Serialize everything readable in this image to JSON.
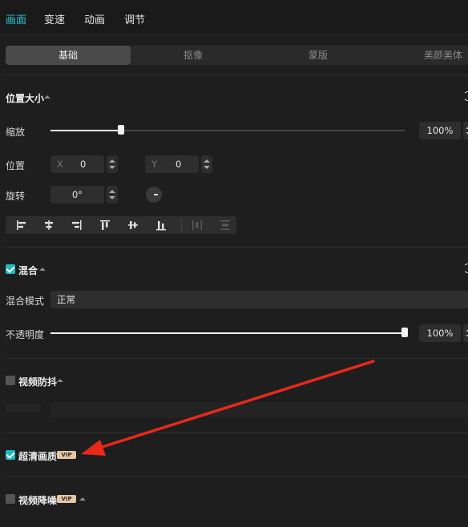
{
  "top_tabs": [
    "画面",
    "变速",
    "动画",
    "调节"
  ],
  "sub_tabs": [
    "基础",
    "抠像",
    "蒙版",
    "美颜美体"
  ],
  "position_size": {
    "title": "位置大小",
    "scale_label": "缩放",
    "scale_value": "100%",
    "scale_level": 0.2,
    "position_label": "位置",
    "x_label": "X",
    "x_value": "0",
    "y_label": "Y",
    "y_value": "0",
    "rotate_label": "旋转",
    "rotate_value": "0°",
    "align_icons": [
      "align-left-icon",
      "align-center-h-icon",
      "align-right-icon",
      "align-top-icon",
      "align-center-v-icon",
      "align-bottom-icon",
      "distribute-h-icon",
      "distribute-v-icon"
    ]
  },
  "blend": {
    "title": "混合",
    "checked": true,
    "mode_label": "混合模式",
    "mode_value": "正常",
    "opacity_label": "不透明度",
    "opacity_value": "100%",
    "opacity_level": 1.0
  },
  "stabilize": {
    "title": "视频防抖",
    "checked": false
  },
  "hd": {
    "title": "超清画质",
    "checked": true,
    "badge": "VIP"
  },
  "denoise": {
    "title": "视频降噪",
    "checked": false,
    "badge": "VIP"
  },
  "colors": {
    "accent": "#26c7d4",
    "checkbox": "#21b9c6",
    "vip": "#e5c6a6",
    "arrow": "#e8291c"
  }
}
